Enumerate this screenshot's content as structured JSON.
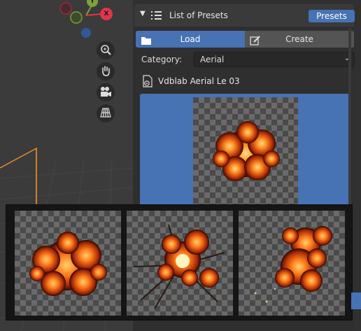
{
  "viewport": {
    "gizmo": {
      "y_label": "Y",
      "x_label": "X"
    },
    "nav_icons": [
      "zoom-icon",
      "hand-pan-icon",
      "camera-icon",
      "grid-perspective-icon"
    ]
  },
  "panel": {
    "header": {
      "title": "List of Presets",
      "presets_button": "Presets"
    },
    "tabs": [
      {
        "label": "Load"
      },
      {
        "label": "Create"
      }
    ],
    "category": {
      "label": "Category:",
      "value": "Aerial"
    },
    "selected_preset": {
      "name": "Vdblab Aerial Le 03"
    }
  },
  "colors": {
    "accent": "#4772b3",
    "panel_bg": "#2f2f2f",
    "viewport_bg": "#3b3b3b",
    "fire": "#ff7a1a"
  },
  "gallery": {
    "thumbnail_count": 3
  }
}
